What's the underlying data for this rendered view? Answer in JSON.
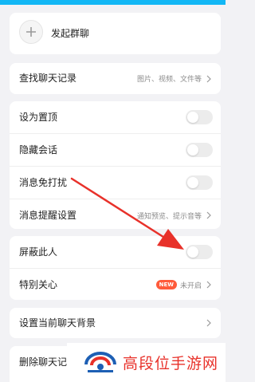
{
  "group_card": {
    "start_group": "发起群聊"
  },
  "search_card": {
    "find_history": "查找聊天记录",
    "find_history_hint": "图片、视频、文件等"
  },
  "settings_card": {
    "pin_top": "设为置顶",
    "hide_chat": "隐藏会话",
    "mute": "消息免打扰",
    "reminder": "消息提醒设置",
    "reminder_hint": "通知预览、提示音等"
  },
  "contact_card": {
    "block": "屏蔽此人",
    "special_care": "特别关心",
    "special_care_badge": "NEW",
    "special_care_status": "未开启"
  },
  "background_card": {
    "set_background": "设置当前聊天背景"
  },
  "delete_card": {
    "delete_history": "删除聊天记"
  },
  "watermark": {
    "text": "高段位手游网"
  },
  "colors": {
    "accent_top": "#12b7f5",
    "arrow": "#e8312a",
    "badge": "#ff5b3b"
  }
}
